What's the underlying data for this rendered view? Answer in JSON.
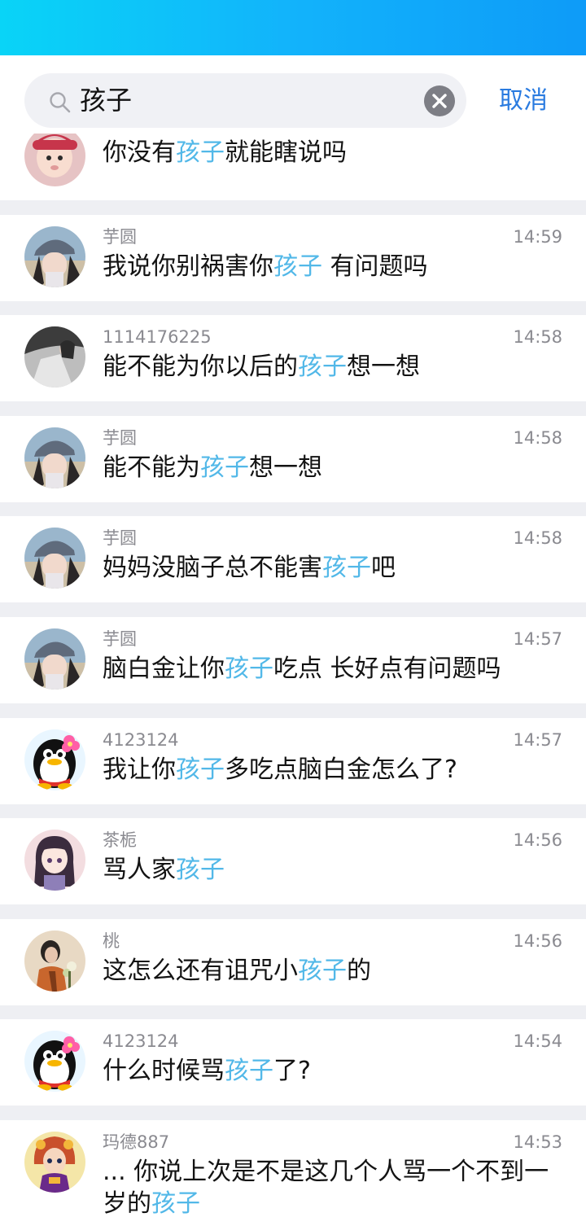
{
  "search": {
    "query": "孩子",
    "cancel_label": "取消"
  },
  "colors": {
    "top_bar_gradient": [
      "#09d4f7",
      "#0e9bf8"
    ],
    "highlight": "#52b8e8",
    "cancel": "#2a7be0"
  },
  "results": [
    {
      "name": "",
      "time": "",
      "avatar": "baby-avatar",
      "parts": [
        "你没有",
        "孩子",
        "就能瞎说吗"
      ]
    },
    {
      "name": "芋圆",
      "time": "14:59",
      "avatar": "girl-hat-avatar",
      "parts": [
        "我说你别祸害你",
        "孩子",
        " 有问题吗"
      ]
    },
    {
      "name": "1114176225",
      "time": "14:58",
      "avatar": "car-girl-avatar",
      "parts": [
        "能不能为你以后的",
        "孩子",
        "想一想"
      ]
    },
    {
      "name": "芋圆",
      "time": "14:58",
      "avatar": "girl-hat-avatar",
      "parts": [
        "能不能为",
        "孩子",
        "想一想"
      ]
    },
    {
      "name": "芋圆",
      "time": "14:58",
      "avatar": "girl-hat-avatar",
      "parts": [
        "妈妈没脑子总不能害",
        "孩子",
        "吧"
      ]
    },
    {
      "name": "芋圆",
      "time": "14:57",
      "avatar": "girl-hat-avatar",
      "parts": [
        "脑白金让你",
        "孩子",
        "吃点 长好点有问题吗"
      ]
    },
    {
      "name": "4123124",
      "time": "14:57",
      "avatar": "penguin-avatar",
      "parts": [
        "我让你",
        "孩子",
        "多吃点脑白金怎么了?"
      ]
    },
    {
      "name": "茶栀",
      "time": "14:56",
      "avatar": "anime-girl-avatar",
      "parts": [
        "骂人家",
        "孩子",
        ""
      ]
    },
    {
      "name": "桃",
      "time": "14:56",
      "avatar": "flower-girl-avatar",
      "parts": [
        "这怎么还有诅咒小",
        "孩子",
        "的"
      ]
    },
    {
      "name": "4123124",
      "time": "14:54",
      "avatar": "penguin-avatar",
      "parts": [
        "什么时候骂",
        "孩子",
        "了?"
      ]
    },
    {
      "name": "玛德887",
      "time": "14:53",
      "avatar": "game-hero-avatar",
      "parts": [
        "... 你说上次是不是这几个人骂一个不到一岁的",
        "孩子",
        ""
      ]
    }
  ]
}
